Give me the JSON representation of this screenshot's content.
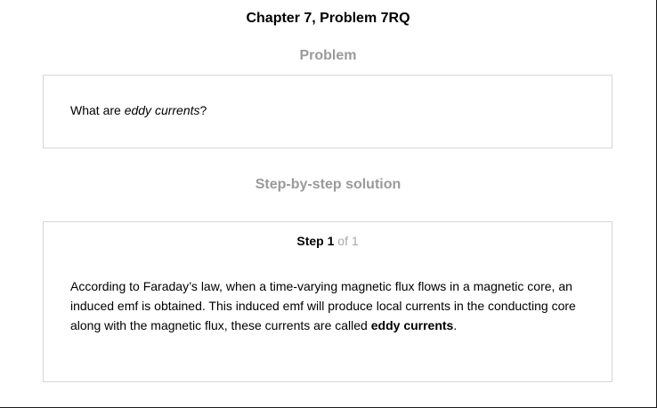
{
  "header": {
    "chapter_title": "Chapter 7, Problem 7RQ"
  },
  "problem": {
    "heading": "Problem",
    "text_before": "What are ",
    "text_emphasis": "eddy currents",
    "text_after": "?"
  },
  "solution": {
    "heading": "Step-by-step solution",
    "step_word": "Step",
    "step_number": "1",
    "step_total": "of 1",
    "text_main": "According to Faraday’s law, when a time-varying magnetic flux flows in a magnetic core, an induced emf is obtained. This induced emf will produce local currents in the conducting core along with the magnetic flux, these currents are called ",
    "text_bold": "eddy currents",
    "text_end": "."
  }
}
